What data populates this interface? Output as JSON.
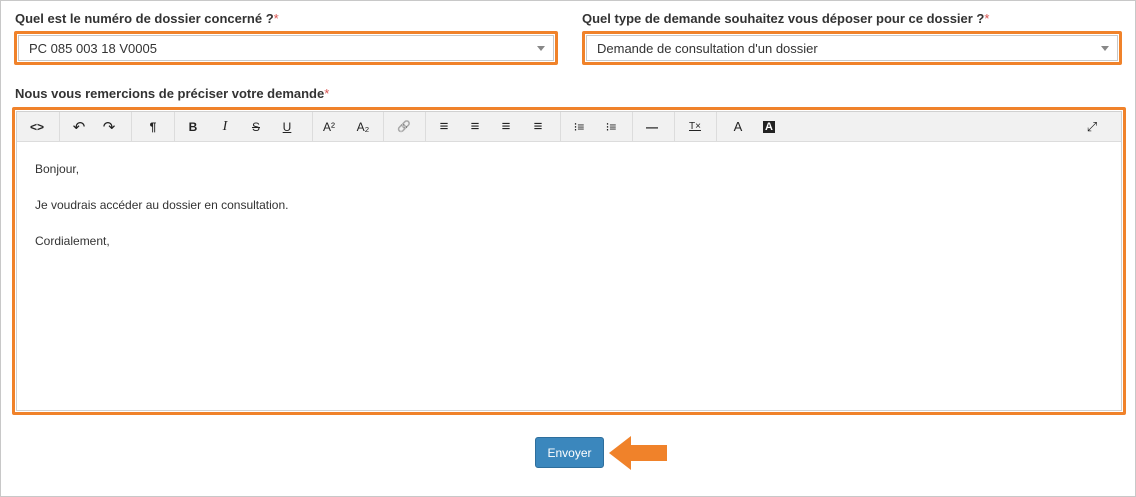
{
  "form": {
    "dossier_label": "Quel est le numéro de dossier concerné ?",
    "dossier_value": "PC 085 003 18 V0005",
    "type_label": "Quel type de demande souhaitez vous déposer pour ce dossier ?",
    "type_value": "Demande de consultation d'un dossier",
    "demande_label": "Nous vous remercions de préciser votre demande",
    "required_mark": "*"
  },
  "editor": {
    "toolbar": [
      {
        "name": "code-view-icon",
        "glyph": "<>"
      },
      {
        "name": "undo-icon",
        "glyph": "↶"
      },
      {
        "name": "redo-icon",
        "glyph": "↷"
      },
      {
        "name": "paragraph-format-icon",
        "glyph": "¶"
      },
      {
        "name": "bold-icon",
        "glyph": "B"
      },
      {
        "name": "italic-icon",
        "glyph": "I"
      },
      {
        "name": "strikethrough-icon",
        "glyph": "S"
      },
      {
        "name": "underline-icon",
        "glyph": "U"
      },
      {
        "name": "superscript-icon",
        "glyph": "A²"
      },
      {
        "name": "subscript-icon",
        "glyph": "A₂"
      },
      {
        "name": "link-icon",
        "glyph": "🔗"
      },
      {
        "name": "align-left-icon",
        "glyph": "≡"
      },
      {
        "name": "align-center-icon",
        "glyph": "≡"
      },
      {
        "name": "align-right-icon",
        "glyph": "≡"
      },
      {
        "name": "align-justify-icon",
        "glyph": "≡"
      },
      {
        "name": "bullet-list-icon",
        "glyph": "⁝≡"
      },
      {
        "name": "numbered-list-icon",
        "glyph": "⁝≡"
      },
      {
        "name": "horizontal-line-icon",
        "glyph": "—"
      },
      {
        "name": "clear-formatting-icon",
        "glyph": "T×"
      },
      {
        "name": "text-color-icon",
        "glyph": "A"
      },
      {
        "name": "background-color-icon",
        "glyph": "A"
      },
      {
        "name": "fullscreen-icon",
        "glyph": "⤢"
      }
    ],
    "lines": [
      "Bonjour,",
      "Je voudrais accéder au dossier en consultation.",
      "Cordialement,"
    ]
  },
  "actions": {
    "submit_label": "Envoyer"
  },
  "colors": {
    "highlight": "#f0822a",
    "button": "#3b87bd",
    "required": "#d9534f"
  }
}
